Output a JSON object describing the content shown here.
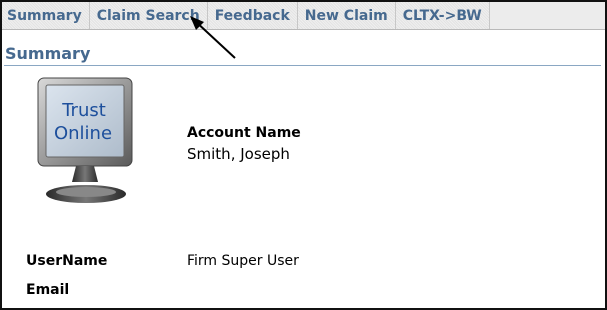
{
  "tabs": [
    {
      "label": "Summary"
    },
    {
      "label": "Claim Search"
    },
    {
      "label": "Feedback"
    },
    {
      "label": "New Claim"
    },
    {
      "label": "CLTX->BW"
    }
  ],
  "page": {
    "title": "Summary"
  },
  "logo": {
    "line1": "Trust",
    "line2": "Online",
    "icon": "monitor-logo-icon"
  },
  "account": {
    "label": "Account Name",
    "value": "Smith, Joseph"
  },
  "fields": {
    "username": {
      "label": "UserName",
      "value": "Firm Super User"
    },
    "email": {
      "label": "Email",
      "value": ""
    }
  },
  "colors": {
    "tab_text": "#46698f",
    "title": "#46698f",
    "rule": "#8aa7c3"
  }
}
